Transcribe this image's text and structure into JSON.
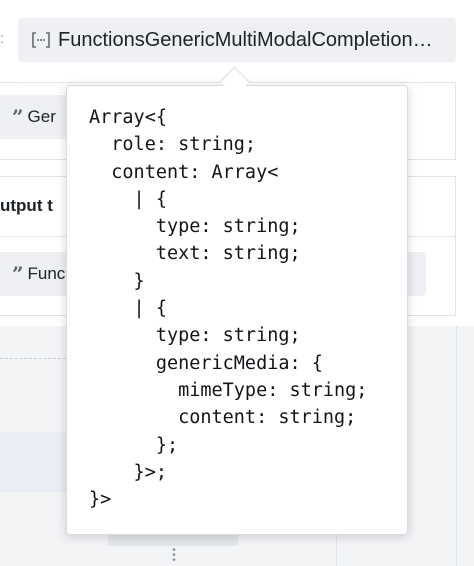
{
  "header": {
    "type_chip_text": "FunctionsGenericMultiModalCompletion…",
    "type_chip_icon": "bracket-type-icon"
  },
  "input_section": {
    "row_text": "Ger"
  },
  "output_section": {
    "label": "utput t",
    "row_text": "Func"
  },
  "popover": {
    "code_lines": [
      "Array<{",
      "  role: string;",
      "  content: Array<",
      "    | {",
      "      type: string;",
      "      text: string;",
      "    }",
      "    | {",
      "      type: string;",
      "      genericMedia: {",
      "        mimeType: string;",
      "        content: string;",
      "      };",
      "    }>;",
      "}>"
    ]
  },
  "colors": {
    "chip_background": "#eef0f3",
    "popover_border": "#d9dde2",
    "page_background": "#f5f6f8"
  }
}
